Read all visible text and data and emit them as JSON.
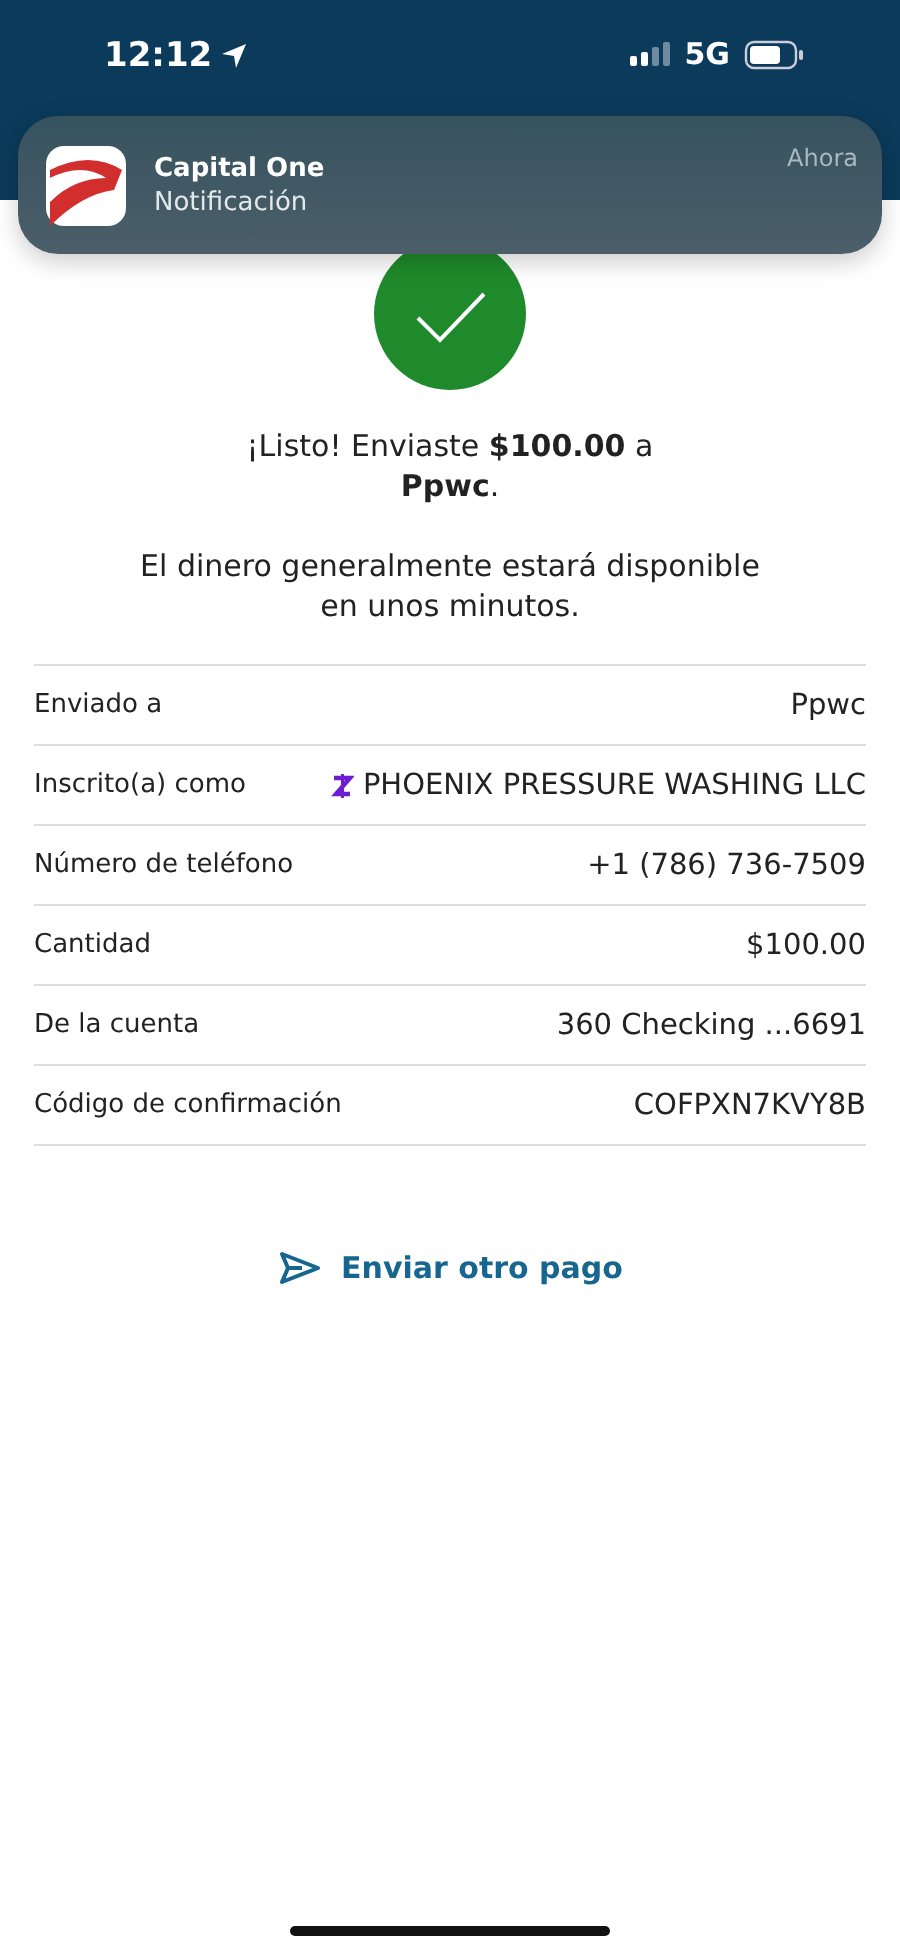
{
  "status_bar": {
    "time": "12:12",
    "network": "5G"
  },
  "notification": {
    "app": "Capital One",
    "text": "Notificación",
    "time": "Ahora"
  },
  "confirmation": {
    "message": "¡Listo! Enviaste **$100.00** a **Ppwc**.",
    "note": "El dinero generalmente estará disponible en unos minutos."
  },
  "details": [
    {
      "kind": "plain",
      "label": "Enviado a",
      "value": "Ppwc"
    },
    {
      "kind": "zelle",
      "label": "Inscrito(a) como",
      "value": "PHOENIX PRESSURE WASHING LLC"
    },
    {
      "kind": "plain",
      "label": "Número de teléfono",
      "value": "+1 (786) 736-7509"
    },
    {
      "kind": "plain",
      "label": "Cantidad",
      "value": "$100.00"
    },
    {
      "kind": "plain",
      "label": "De la cuenta",
      "value": "360 Checking ...6691"
    },
    {
      "kind": "plain",
      "label": "Código de confirmación",
      "value": "COFPXN7KVY8B"
    }
  ],
  "action": {
    "label": "Enviar otro pago"
  }
}
